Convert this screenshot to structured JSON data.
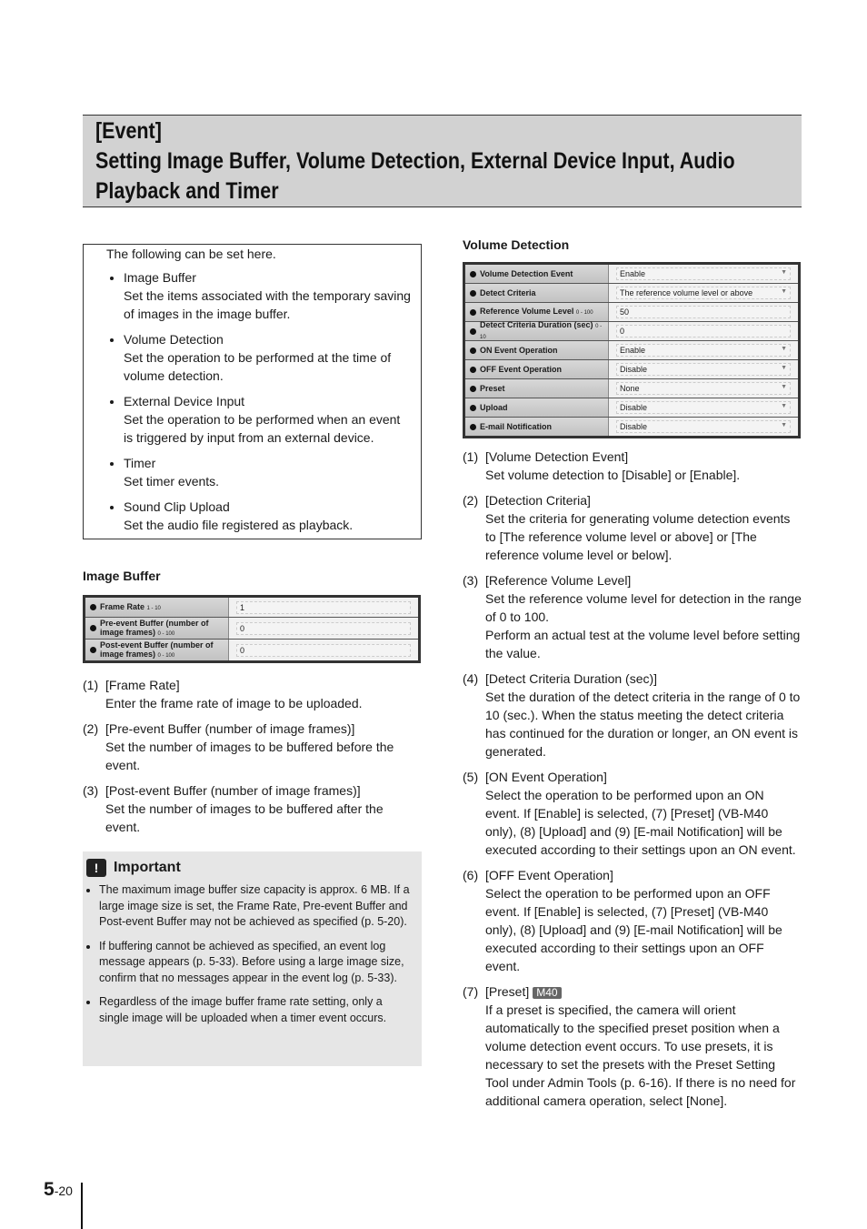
{
  "header": {
    "lines": [
      "[Event]",
      "Setting Image Buffer, Volume Detection, External Device Input, Audio",
      "Playback and Timer"
    ]
  },
  "intro": {
    "lead": "The following can be set here.",
    "items": [
      {
        "title": "Image Buffer",
        "text": "Set the items associated with the temporary saving of images in the image buffer."
      },
      {
        "title": "Volume Detection",
        "text": "Set the operation to be performed at the time of volume detection."
      },
      {
        "title": "External Device Input",
        "text": "Set the operation to be performed when an event is triggered by input from an external device."
      },
      {
        "title": "Timer",
        "text": "Set timer events."
      },
      {
        "title": "Sound Clip Upload",
        "text": "Set the audio file registered as playback."
      }
    ]
  },
  "image_buffer": {
    "heading": "Image Buffer",
    "rows": [
      {
        "label": "Frame Rate",
        "range": "1 - 10",
        "value": "1"
      },
      {
        "label": "Pre-event Buffer (number of image frames)",
        "range": "0 - 100",
        "value": "0"
      },
      {
        "label": "Post-event Buffer (number of image frames)",
        "range": "0 - 100",
        "value": "0"
      }
    ],
    "items": [
      {
        "num": "(1)",
        "title": "[Frame Rate]",
        "body": "Enter the frame rate of image to be uploaded."
      },
      {
        "num": "(2)",
        "title": "[Pre-event Buffer (number of image frames)]",
        "body": "Set the number of images to be buffered before the event."
      },
      {
        "num": "(3)",
        "title": "[Post-event Buffer (number of image frames)]",
        "body": "Set the number of images to be buffered after the event."
      }
    ]
  },
  "important": {
    "title": "Important",
    "bullets": [
      "The maximum image buffer size capacity is approx. 6 MB. If a large image size is set, the Frame Rate, Pre-event Buffer and Post-event Buffer may not be achieved as specified (p. 5-20).",
      "If buffering cannot be achieved as specified, an event log message appears (p. 5-33). Before using a large image size, confirm that no messages appear in the event log (p. 5-33).",
      "Regardless of the image buffer frame rate setting, only a single image will be uploaded when a timer event occurs."
    ]
  },
  "volume": {
    "heading": "Volume Detection",
    "rows": [
      {
        "label": "Volume Detection Event",
        "range": "",
        "value": "Enable",
        "dropdown": true
      },
      {
        "label": "Detect Criteria",
        "range": "",
        "value": "The reference volume level or above",
        "dropdown": true
      },
      {
        "label": "Reference Volume Level",
        "range": "0 - 100",
        "value": "50",
        "dropdown": false
      },
      {
        "label": "Detect Criteria Duration (sec)",
        "range": "0 - 10",
        "value": "0",
        "dropdown": false
      },
      {
        "label": "ON Event Operation",
        "range": "",
        "value": "Enable",
        "dropdown": true
      },
      {
        "label": "OFF Event Operation",
        "range": "",
        "value": "Disable",
        "dropdown": true
      },
      {
        "label": "Preset",
        "range": "",
        "value": "None",
        "dropdown": true
      },
      {
        "label": "Upload",
        "range": "",
        "value": "Disable",
        "dropdown": true
      },
      {
        "label": "E-mail Notification",
        "range": "",
        "value": "Disable",
        "dropdown": true
      }
    ],
    "items": [
      {
        "num": "(1)",
        "title": "[Volume Detection Event]",
        "body": "Set volume detection to [Disable] or [Enable]."
      },
      {
        "num": "(2)",
        "title": "[Detection Criteria]",
        "body": "Set the criteria for generating volume detection events to [The reference volume level or above] or [The reference volume level or below]."
      },
      {
        "num": "(3)",
        "title": "[Reference Volume Level]",
        "body": "Set the reference volume level for detection in the range of 0 to 100.\nPerform an actual test at the volume level before setting the value."
      },
      {
        "num": "(4)",
        "title": "[Detect Criteria Duration (sec)]",
        "body": "Set the duration of the detect criteria in the range of 0 to 10 (sec.). When the status meeting the detect criteria has continued for the duration or longer, an ON event is generated."
      },
      {
        "num": "(5)",
        "title": "[ON Event Operation]",
        "body": "Select the operation to be performed upon an ON event. If [Enable] is selected, (7) [Preset] (VB-M40 only), (8) [Upload] and (9) [E-mail Notification] will be executed according to their settings upon an ON event."
      },
      {
        "num": "(6)",
        "title": "[OFF Event Operation]",
        "body": "Select the operation to be performed upon an OFF event. If [Enable] is selected, (7) [Preset] (VB-M40 only), (8) [Upload] and (9) [E-mail Notification] will be executed according to their settings upon an OFF event."
      },
      {
        "num": "(7)",
        "title": "[Preset]",
        "badge": "M40",
        "body": "If a preset is specified, the camera will orient automatically to the specified preset position when a volume detection event occurs. To use presets, it is necessary to set the presets with the Preset Setting Tool under Admin Tools (p. 6-16). If there is no need for additional camera operation, select [None]."
      }
    ]
  },
  "footer": {
    "chapter": "5",
    "page": "-20"
  }
}
